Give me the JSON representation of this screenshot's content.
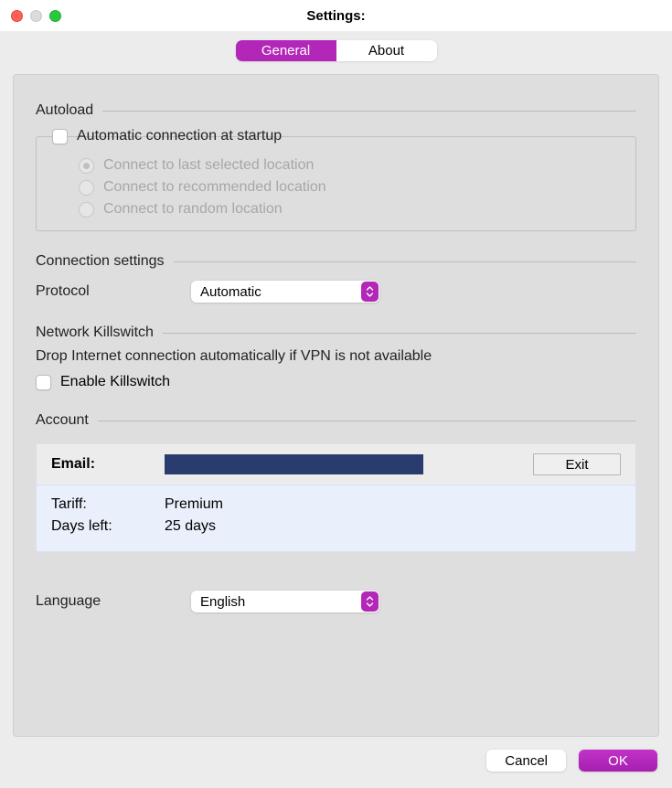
{
  "window": {
    "title": "Settings:"
  },
  "tabs": {
    "general": "General",
    "about": "About"
  },
  "sections": {
    "autoload": {
      "title": "Autoload",
      "checkbox_label": "Automatic connection at startup",
      "radios": {
        "last": "Connect to last selected location",
        "recommended": "Connect to recommended location",
        "random": "Connect to random location"
      }
    },
    "connection": {
      "title": "Connection settings",
      "protocol_label": "Protocol",
      "protocol_value": "Automatic"
    },
    "killswitch": {
      "title": "Network Killswitch",
      "description": "Drop Internet connection automatically if VPN is not available",
      "checkbox_label": "Enable Killswitch"
    },
    "account": {
      "title": "Account",
      "email_label": "Email:",
      "email_value": "",
      "exit": "Exit",
      "tariff_label": "Tariff:",
      "tariff_value": "Premium",
      "daysleft_label": "Days left:",
      "daysleft_value": "25 days"
    },
    "language": {
      "label": "Language",
      "value": "English"
    }
  },
  "footer": {
    "cancel": "Cancel",
    "ok": "OK"
  },
  "colors": {
    "accent": "#b327b8"
  }
}
